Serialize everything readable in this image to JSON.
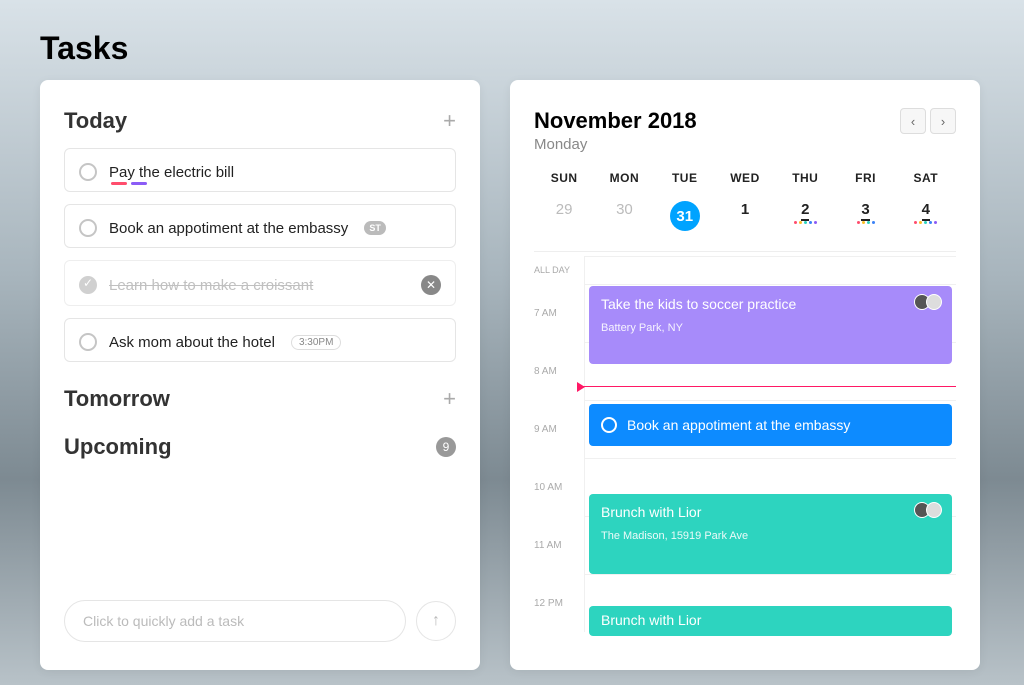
{
  "page": {
    "title": "Tasks"
  },
  "sections": {
    "today": {
      "title": "Today"
    },
    "tomorrow": {
      "title": "Tomorrow"
    },
    "upcoming": {
      "title": "Upcoming",
      "count": "9"
    }
  },
  "tasks": {
    "today": [
      {
        "text": "Pay the electric bill",
        "done": false,
        "ticks": [
          "red",
          "purple"
        ]
      },
      {
        "text": "Book an appotiment at the embassy",
        "done": false,
        "tag": "ST"
      },
      {
        "text": "Learn how to make a croissant",
        "done": true
      },
      {
        "text": "Ask mom about the hotel",
        "done": false,
        "time": "3:30PM"
      }
    ]
  },
  "quickadd": {
    "placeholder": "Click to quickly add a task"
  },
  "calendar": {
    "title": "November 2018",
    "subtitle": "Monday",
    "days": [
      "SUN",
      "MON",
      "TUE",
      "WED",
      "THU",
      "FRI",
      "SAT"
    ],
    "dates": [
      {
        "num": "29",
        "muted": true
      },
      {
        "num": "30",
        "muted": true
      },
      {
        "num": "31",
        "selected": true
      },
      {
        "num": "1"
      },
      {
        "num": "2",
        "underline": true,
        "dots": true
      },
      {
        "num": "3",
        "underline": true,
        "dots": true
      },
      {
        "num": "4",
        "underline": true,
        "dots": true
      }
    ],
    "allday": "ALL DAY",
    "hours": [
      "7 AM",
      "8 AM",
      "9 AM",
      "10 AM",
      "11 AM",
      "12 PM"
    ],
    "events": {
      "soccer": {
        "title": "Take the kids to soccer practice",
        "location": "Battery Park, NY"
      },
      "embassy": {
        "title": "Book an appotiment at the embassy"
      },
      "brunch": {
        "title": "Brunch with Lior",
        "location": "The Madison, 15919 Park Ave"
      },
      "brunch2": {
        "title": "Brunch with Lior"
      }
    }
  }
}
